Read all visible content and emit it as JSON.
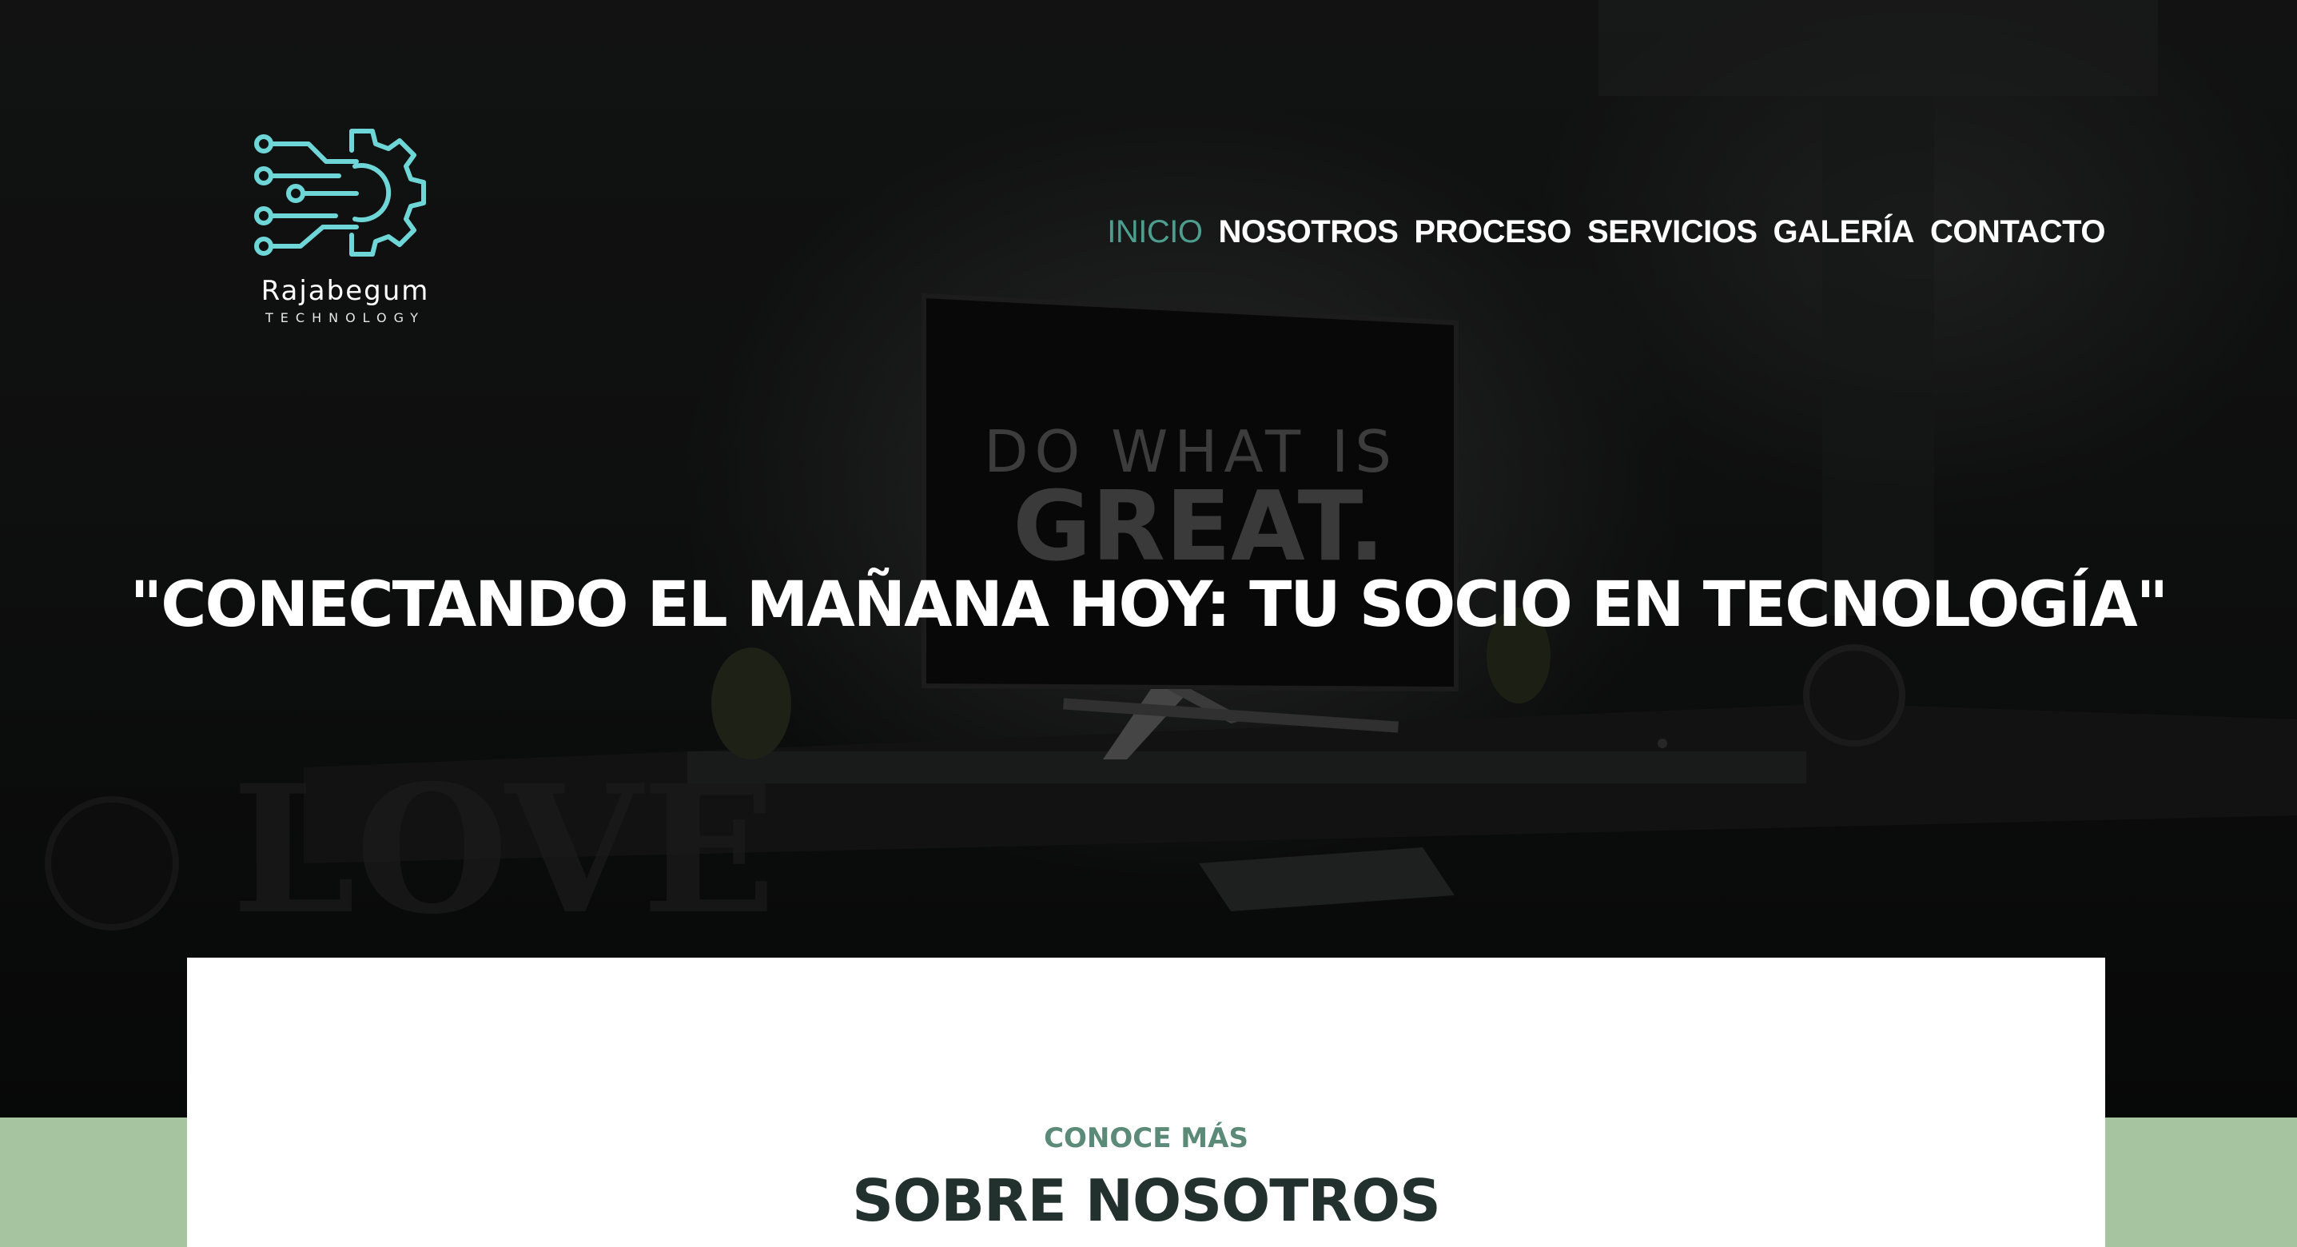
{
  "brand": {
    "name": "Rajabegum",
    "tagline": "TECHNOLOGY",
    "icon": "circuit-gear-icon",
    "icon_color": "#6fd6d8"
  },
  "nav": {
    "items": [
      {
        "label": "INICIO",
        "active": true
      },
      {
        "label": "NOSOTROS",
        "active": false
      },
      {
        "label": "PROCESO",
        "active": false
      },
      {
        "label": "SERVICIOS",
        "active": false
      },
      {
        "label": "GALERÍA",
        "active": false
      },
      {
        "label": "CONTACTO",
        "active": false
      }
    ],
    "active_color": "#4d9e8e"
  },
  "hero": {
    "headline": "\"CONECTANDO EL MAÑANA HOY: TU SOCIO EN TECNOLOGÍA\"",
    "monitor_text_line1": "DO WHAT IS",
    "monitor_text_line2": "GREAT.",
    "background_word": "LOVE"
  },
  "about": {
    "eyebrow": "CONOCE MÁS",
    "title": "SOBRE NOSOTROS"
  },
  "colors": {
    "accent_green": "#a6c4a0",
    "heading_dark": "#22312e",
    "eyebrow_green": "#5b8a78"
  }
}
